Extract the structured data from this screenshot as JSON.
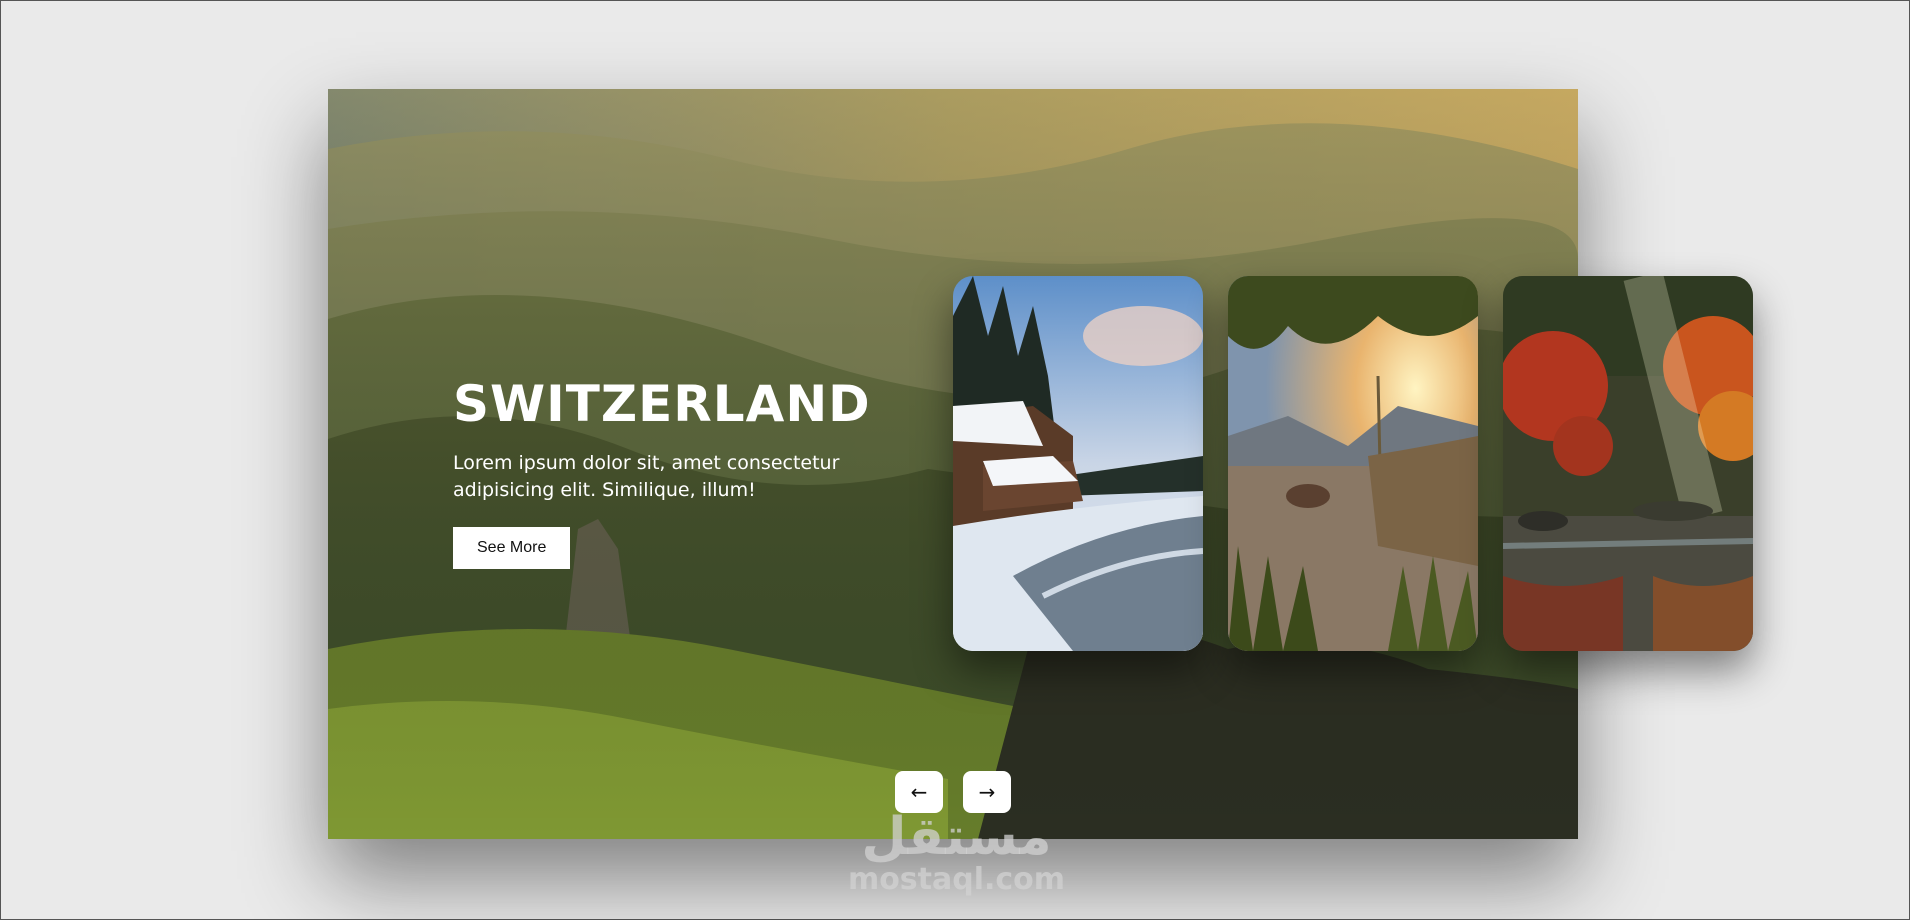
{
  "hero": {
    "title": "SWITZERLAND",
    "description": "Lorem ipsum dolor sit, amet consectetur adipisicing elit. Similique, illum!",
    "button_label": "See More"
  },
  "cards": [
    {
      "scene": "snowy-cabin-river"
    },
    {
      "scene": "lake-sunset"
    },
    {
      "scene": "autumn-forest-river"
    }
  ],
  "nav": {
    "prev_icon": "←",
    "next_icon": "→"
  },
  "watermark": {
    "logo_text": "مستقل",
    "site": "mostaql.com"
  },
  "colors": {
    "background": "#eaeaea",
    "button_bg": "#ffffff",
    "text_light": "#ffffff"
  }
}
